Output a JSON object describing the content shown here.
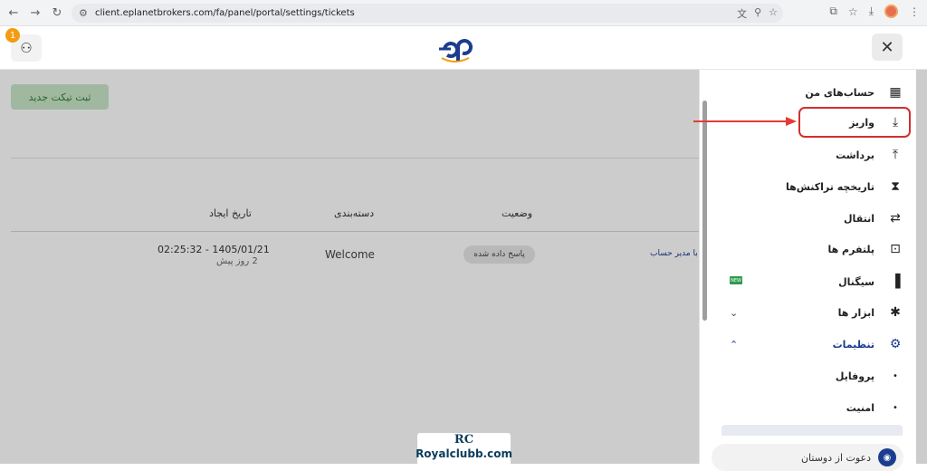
{
  "browser": {
    "url": "client.eplanetbrokers.com/fa/panel/portal/settings/tickets",
    "back_icon": "arrow-left-icon",
    "forward_icon": "arrow-right-icon",
    "reload_icon": "reload-icon"
  },
  "header": {
    "notification_count": "1",
    "logo_text": "ep",
    "close_symbol": "✕",
    "user_symbol": "⚇"
  },
  "page": {
    "new_ticket_label": "ثبت تیکت جدید",
    "columns": [
      "تاریخ ایجاد",
      "دسته‌بندی",
      "وضعیت"
    ],
    "row": {
      "created": "02:25:32 - 1405/01/21",
      "ago": "2 روز پیش",
      "category": "Welcome",
      "status": "پاسخ داده شده",
      "by": "با مدیر حساب"
    }
  },
  "sidebar": {
    "items": [
      {
        "label": "حساب‌های من",
        "icon": "▦"
      },
      {
        "label": "واریز",
        "icon": "⤓"
      },
      {
        "label": "برداشت",
        "icon": "⤒"
      },
      {
        "label": "تاریخچه تراکنش‌ها",
        "icon": "⧗"
      },
      {
        "label": "انتقال",
        "icon": "⇄"
      },
      {
        "label": "پلتفرم ها",
        "icon": "⊡"
      },
      {
        "label": "سیگنال",
        "icon": "▐",
        "badge": "NEW"
      },
      {
        "label": "ابزار ها",
        "icon": "✱",
        "extra": "⌄"
      },
      {
        "label": "تنظیمات",
        "icon": "⚙",
        "extra": "⌃"
      }
    ],
    "sub_items": [
      {
        "label": "پروفایل",
        "dot": "•"
      },
      {
        "label": "امنیت",
        "dot": "•"
      }
    ],
    "invite_label": "دعوت از دوستان",
    "invite_icon": "◉"
  },
  "watermark": {
    "mark": "RC",
    "text": "Royalclubb.com"
  },
  "colors": {
    "accent": "#1a3d8f",
    "highlight": "#d32f2f",
    "new_ticket_bg": "#c8e6c9",
    "logo_blue": "#1a3d8f",
    "logo_orange": "#f39c12"
  }
}
